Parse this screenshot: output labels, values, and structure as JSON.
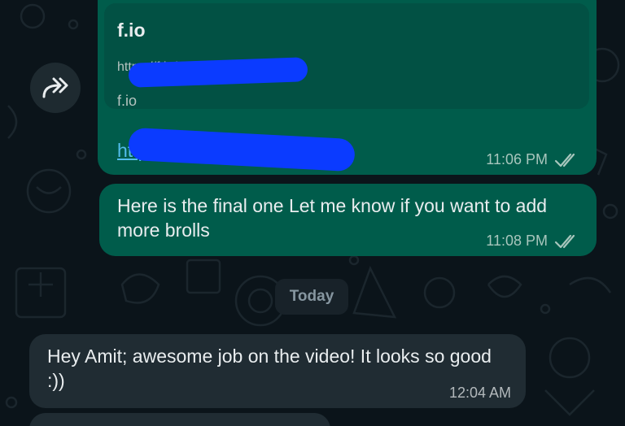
{
  "link_message": {
    "preview_title": "f.io",
    "preview_url": "https://f.io/UOCk",
    "preview_domain": "f.io",
    "link_text": "https://f.io/UOCk",
    "time": "11:06 PM"
  },
  "message_2": {
    "text": "Here is the final one Let me know if you want to add  more brolls",
    "time": "11:08 PM"
  },
  "date_divider": "Today",
  "message_3": {
    "text": "Hey Amit; awesome job on the video! It looks so good :))",
    "time": "12:04 AM"
  },
  "colors": {
    "background": "#0b141a",
    "outgoing_bubble": "#005c4b",
    "incoming_bubble": "#202c33",
    "link": "#53bdeb",
    "redaction": "#0b3bff"
  },
  "icons": [
    "forward-icon",
    "double-check-icon"
  ]
}
